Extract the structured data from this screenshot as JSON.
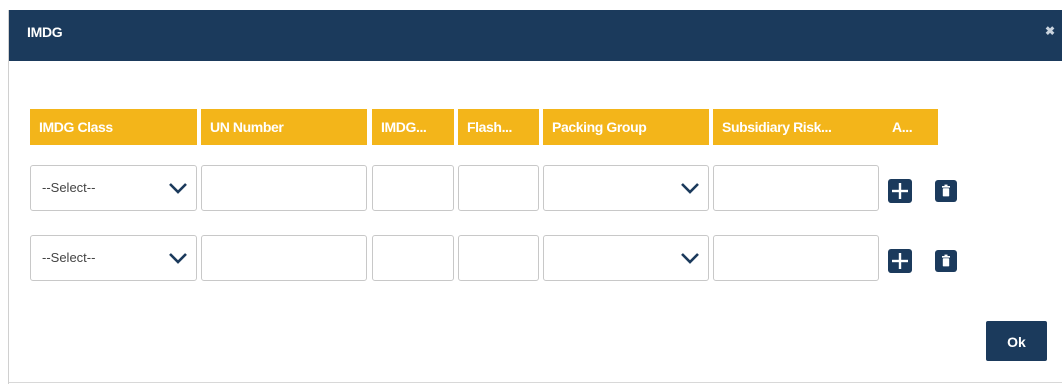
{
  "dialog": {
    "title": "IMDG",
    "close_glyph": "✖",
    "ok_label": "Ok"
  },
  "table": {
    "columns": [
      "IMDG Class",
      "UN Number",
      "IMDG...",
      "Flash...",
      "Packing Group",
      "Subsidiary Risk...",
      "A..."
    ],
    "rows": [
      {
        "imdg_class": "--Select--",
        "un_number": "",
        "imdg": "",
        "flash": "",
        "packing_group": "",
        "subsidiary_risk": ""
      },
      {
        "imdg_class": "--Select--",
        "un_number": "",
        "imdg": "",
        "flash": "",
        "packing_group": "",
        "subsidiary_risk": ""
      }
    ]
  },
  "icons": {
    "add": "plus-icon",
    "delete": "trash-icon",
    "dropdown": "chevron-down-icon",
    "close": "close-icon"
  },
  "colors": {
    "header_bg": "#1b3a5c",
    "column_header_bg": "#f3b51a",
    "button_bg": "#1b3a5c"
  }
}
